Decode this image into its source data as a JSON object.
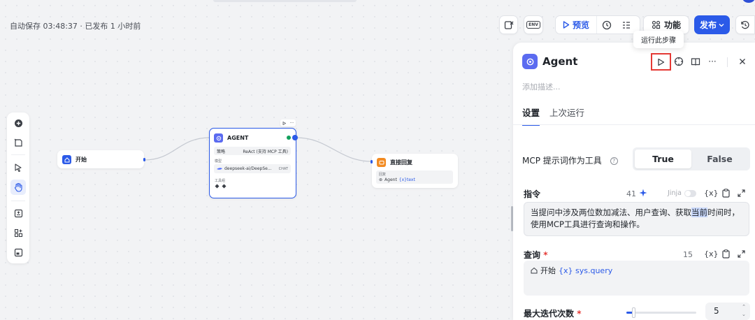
{
  "header": {
    "autosave": "自动保存 03:48:37 · 已发布 1 小时前",
    "env_label": "ENV",
    "preview_label": "预览",
    "features_label": "功能",
    "publish_label": "发布",
    "tooltip": "运行此步骤"
  },
  "workflow": {
    "start_node": {
      "title": "开始"
    },
    "agent_node": {
      "title": "AGENT",
      "strategy_label": "策略",
      "strategy_value": "ReAct (支持 MCP 工具)",
      "model_label": "模型",
      "model_value": "deepseek-ai/DeepSe...",
      "model_tag": "CHAT",
      "tools_label": "工具组"
    },
    "reply_node": {
      "title": "直接回复",
      "reply_label": "回复",
      "reply_source": "Agent",
      "reply_var": "{x}text"
    }
  },
  "panel": {
    "title": "Agent",
    "description_placeholder": "添加描述...",
    "tabs": [
      "设置",
      "上次运行"
    ],
    "mcp_label": "MCP 提示词作为工具",
    "mcp_options": [
      "True",
      "False"
    ],
    "mcp_selected": "True",
    "instruction": {
      "label": "指令",
      "count": "41",
      "jinja_label": "Jinja",
      "text_before": "当提问中涉及两位数加减法、用户查询、获取",
      "text_highlight": "当前",
      "text_after": "时间时，使用MCP工具进行查询和操作。"
    },
    "query": {
      "label": "查询",
      "required": "*",
      "count": "15",
      "source": "开始",
      "var": "{x} sys.query"
    },
    "max_iter": {
      "label": "最大迭代次数",
      "required": "*",
      "value": "5",
      "slider_fraction": 0.1
    }
  },
  "colors": {
    "accent": "#2b5ae8",
    "agent_icon": "#5b6bf0",
    "start_icon": "#2b5ae8",
    "reply_icon": "#f28b22",
    "highlight_border": "#e53935",
    "status_ok": "#12a05c"
  }
}
